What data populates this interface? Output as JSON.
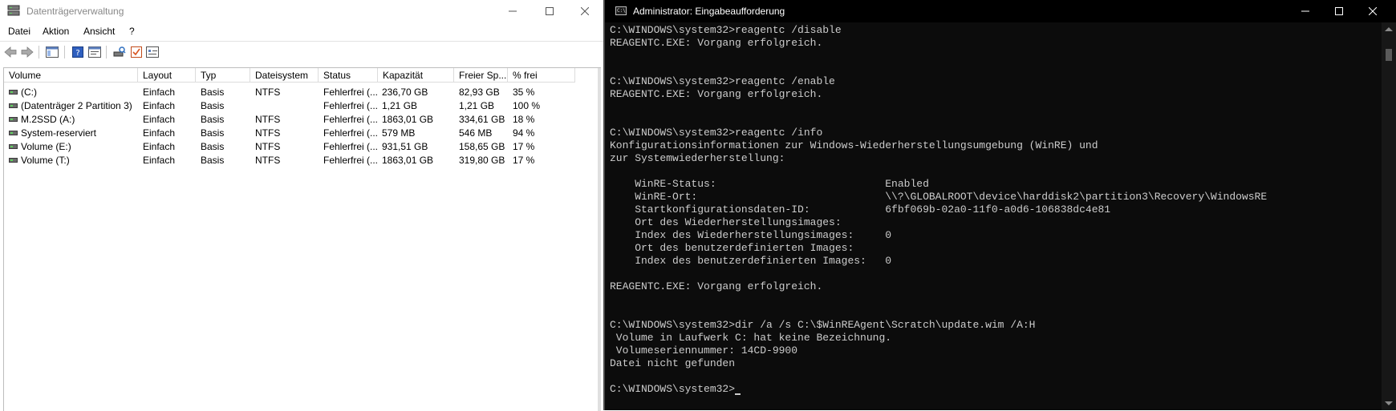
{
  "disk_mgmt": {
    "title": "Datenträgerverwaltung",
    "menu": [
      "Datei",
      "Aktion",
      "Ansicht",
      "?"
    ],
    "toolbar_icons": [
      "back-arrow-icon",
      "forward-arrow-icon",
      "show-hide-console-tree-icon",
      "help-icon",
      "properties-icon",
      "rescan-disks-icon",
      "checklist-icon",
      "view-icon"
    ],
    "columns": [
      "Volume",
      "Layout",
      "Typ",
      "Dateisystem",
      "Status",
      "Kapazität",
      "Freier Sp...",
      "% frei"
    ],
    "rows": [
      {
        "volume": " (C:)",
        "layout": "Einfach",
        "typ": "Basis",
        "fs": "NTFS",
        "status": "Fehlerfrei (...",
        "capacity": "236,70 GB",
        "free": "82,93 GB",
        "pct": "35 %"
      },
      {
        "volume": "(Datenträger 2 Partition 3)",
        "layout": "Einfach",
        "typ": "Basis",
        "fs": "",
        "status": "Fehlerfrei (...",
        "capacity": "1,21 GB",
        "free": "1,21 GB",
        "pct": "100 %"
      },
      {
        "volume": "M.2SSD (A:)",
        "layout": "Einfach",
        "typ": "Basis",
        "fs": "NTFS",
        "status": "Fehlerfrei (...",
        "capacity": "1863,01 GB",
        "free": "334,61 GB",
        "pct": "18 %"
      },
      {
        "volume": "System-reserviert",
        "layout": "Einfach",
        "typ": "Basis",
        "fs": "NTFS",
        "status": "Fehlerfrei (...",
        "capacity": "579 MB",
        "free": "546 MB",
        "pct": "94 %"
      },
      {
        "volume": "Volume (E:)",
        "layout": "Einfach",
        "typ": "Basis",
        "fs": "NTFS",
        "status": "Fehlerfrei (...",
        "capacity": "931,51 GB",
        "free": "158,65 GB",
        "pct": "17 %"
      },
      {
        "volume": "Volume (T:)",
        "layout": "Einfach",
        "typ": "Basis",
        "fs": "NTFS",
        "status": "Fehlerfrei (...",
        "capacity": "1863,01 GB",
        "free": "319,80 GB",
        "pct": "17 %"
      }
    ]
  },
  "cmd": {
    "title": "Administrator: Eingabeaufforderung",
    "icon_text": "C:\\",
    "lines": [
      "C:\\WINDOWS\\system32>reagentc /disable",
      "REAGENTC.EXE: Vorgang erfolgreich.",
      "",
      "",
      "C:\\WINDOWS\\system32>reagentc /enable",
      "REAGENTC.EXE: Vorgang erfolgreich.",
      "",
      "",
      "C:\\WINDOWS\\system32>reagentc /info",
      "Konfigurationsinformationen zur Windows-Wiederherstellungsumgebung (WinRE) und",
      "zur Systemwiederherstellung:",
      "",
      "    WinRE-Status:                           Enabled",
      "    WinRE-Ort:                              \\\\?\\GLOBALROOT\\device\\harddisk2\\partition3\\Recovery\\WindowsRE",
      "    Startkonfigurationsdaten-ID:            6fbf069b-02a0-11f0-a0d6-106838dc4e81",
      "    Ort des Wiederherstellungsimages:",
      "    Index des Wiederherstellungsimages:     0",
      "    Ort des benutzerdefinierten Images:",
      "    Index des benutzerdefinierten Images:   0",
      "",
      "REAGENTC.EXE: Vorgang erfolgreich.",
      "",
      "",
      "C:\\WINDOWS\\system32>dir /a /s C:\\$WinREAgent\\Scratch\\update.wim /A:H",
      " Volume in Laufwerk C: hat keine Bezeichnung.",
      " Volumeseriennummer: 14CD-9900",
      "Datei nicht gefunden",
      "",
      "C:\\WINDOWS\\system32>"
    ]
  }
}
